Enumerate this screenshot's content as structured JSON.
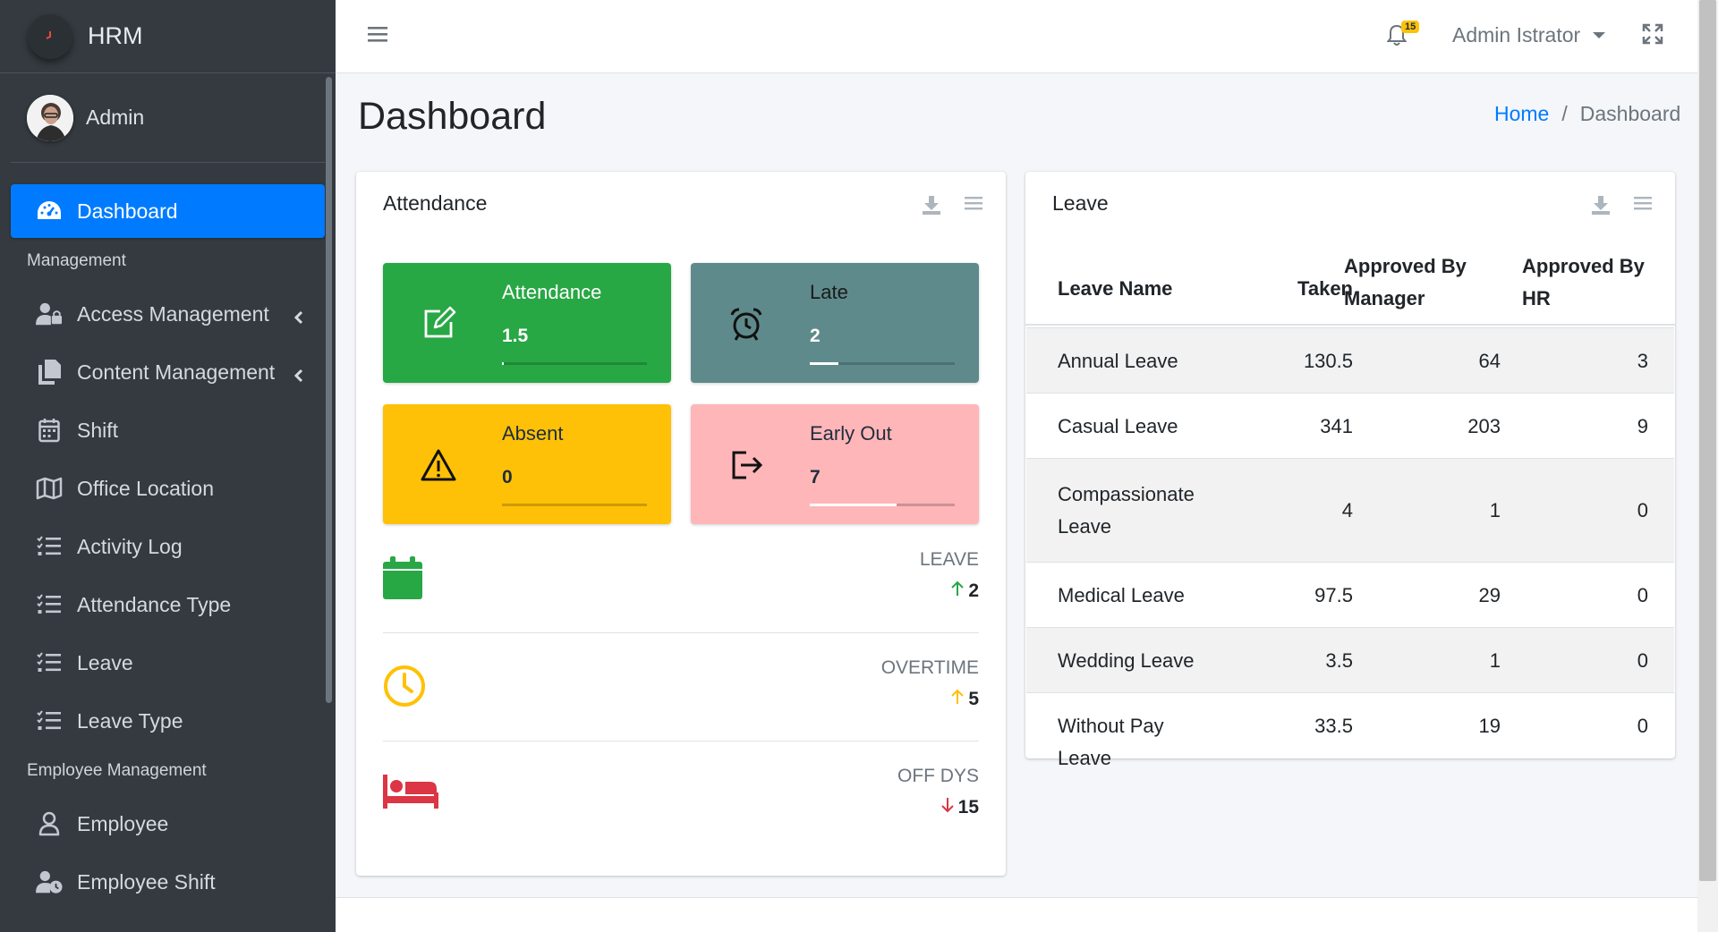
{
  "brand": {
    "name": "HRM"
  },
  "user": {
    "name": "Admin"
  },
  "sidebar": {
    "items": [
      {
        "label": "Dashboard",
        "icon": "tachometer-icon",
        "active": true
      },
      {
        "label": "Access Management",
        "icon": "user-lock-icon"
      },
      {
        "label": "Content Management",
        "icon": "copy-icon"
      },
      {
        "label": "Shift",
        "icon": "calendar-icon"
      },
      {
        "label": "Office Location",
        "icon": "map-icon"
      },
      {
        "label": "Activity Log",
        "icon": "list-icon"
      },
      {
        "label": "Attendance Type",
        "icon": "list-icon"
      },
      {
        "label": "Leave",
        "icon": "list-icon"
      },
      {
        "label": "Leave Type",
        "icon": "list-icon"
      },
      {
        "label": "Employee",
        "icon": "user-icon"
      },
      {
        "label": "Employee Shift",
        "icon": "user-clock-icon"
      }
    ],
    "headers": {
      "management": "Management",
      "employee_management": "Employee Management"
    }
  },
  "topbar": {
    "notification_count": "15",
    "user_menu": "Admin Istrator"
  },
  "page": {
    "title": "Dashboard",
    "breadcrumb": {
      "home": "Home",
      "current": "Dashboard"
    }
  },
  "attendance_card": {
    "title": "Attendance",
    "boxes": [
      {
        "label": "Attendance",
        "value": "1.5",
        "color": "#28a745",
        "progress": 0.01,
        "icon": "edit-icon"
      },
      {
        "label": "Late",
        "value": "2",
        "color": "#5f8a8b",
        "progress": 0.2,
        "icon": "alarm-clock-icon"
      },
      {
        "label": "Absent",
        "value": "0",
        "color": "#ffc107",
        "progress": 0,
        "icon": "warning-icon"
      },
      {
        "label": "Early Out",
        "value": "7",
        "color": "#ffb6b9",
        "progress": 0.6,
        "icon": "sign-out-icon"
      }
    ],
    "stats": [
      {
        "label": "LEAVE",
        "value": "2",
        "trend": "up",
        "color": "#28a745",
        "icon": "calendar-icon"
      },
      {
        "label": "OVERTIME",
        "value": "5",
        "trend": "up",
        "color": "#ffc107",
        "icon": "clock-icon"
      },
      {
        "label": "OFF DYS",
        "value": "15",
        "trend": "down",
        "color": "#dc3545",
        "icon": "bed-icon"
      }
    ]
  },
  "leave_card": {
    "title": "Leave",
    "columns": [
      "Leave Name",
      "Taken",
      "Approved By Manager",
      "Approved By HR"
    ],
    "rows": [
      {
        "name": "Annual Leave",
        "taken": "130.5",
        "manager": "64",
        "hr": "3"
      },
      {
        "name": "Casual Leave",
        "taken": "341",
        "manager": "203",
        "hr": "9"
      },
      {
        "name": "Compassionate Leave",
        "taken": "4",
        "manager": "1",
        "hr": "0"
      },
      {
        "name": "Medical Leave",
        "taken": "97.5",
        "manager": "29",
        "hr": "0"
      },
      {
        "name": "Wedding Leave",
        "taken": "3.5",
        "manager": "1",
        "hr": "0"
      },
      {
        "name": "Without Pay Leave",
        "taken": "33.5",
        "manager": "19",
        "hr": "0"
      }
    ]
  }
}
